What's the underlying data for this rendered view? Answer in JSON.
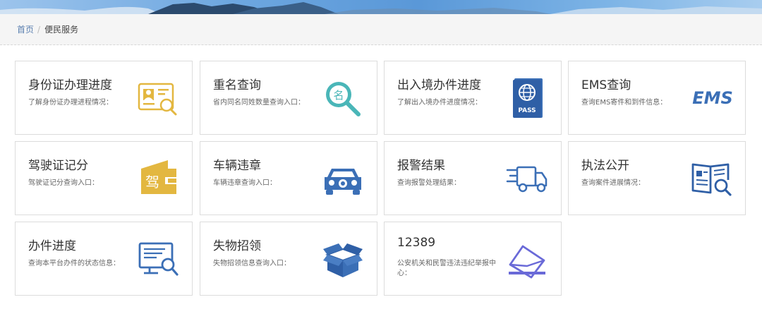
{
  "breadcrumb": {
    "home": "首页",
    "separator": "/",
    "current": "便民服务"
  },
  "colors": {
    "title": "#333333",
    "desc": "#666666",
    "border": "#dcdcdc",
    "brand_blue": "#3b6fb6",
    "teal": "#4ab6b8",
    "gold": "#e3b740"
  },
  "services": [
    {
      "title": "身份证办理进度",
      "desc": "了解身份证办理进程情况：",
      "icon": "id-card-search-icon"
    },
    {
      "title": "重名查询",
      "desc": "省内同名同姓数量查询入口：",
      "icon": "name-magnifier-icon"
    },
    {
      "title": "出入境办件进度",
      "desc": "了解出入境办件进度情况：",
      "icon": "passport-icon",
      "icon_text": "PASS"
    },
    {
      "title": "EMS查询",
      "desc": "查询EMS寄件和到件信息：",
      "icon": "ems-logo-icon",
      "icon_text": "EMS"
    },
    {
      "title": "驾驶证记分",
      "desc": "驾驶证记分查询入口：",
      "icon": "driver-license-icon",
      "icon_text": "驾"
    },
    {
      "title": "车辆违章",
      "desc": "车辆违章查询入口：",
      "icon": "car-icon"
    },
    {
      "title": "报警结果",
      "desc": "查询报警处理结果：",
      "icon": "delivery-truck-icon"
    },
    {
      "title": "执法公开",
      "desc": "查询案件进展情况：",
      "icon": "book-search-icon"
    },
    {
      "title": "办件进度",
      "desc": "查询本平台办件的状态信息：",
      "icon": "monitor-search-icon"
    },
    {
      "title": "失物招领",
      "desc": "失物招领信息查询入口：",
      "icon": "open-box-icon"
    },
    {
      "title": "12389",
      "desc": "公安机关和民警违法违纪举报中心：",
      "icon": "envelope-icon"
    }
  ]
}
